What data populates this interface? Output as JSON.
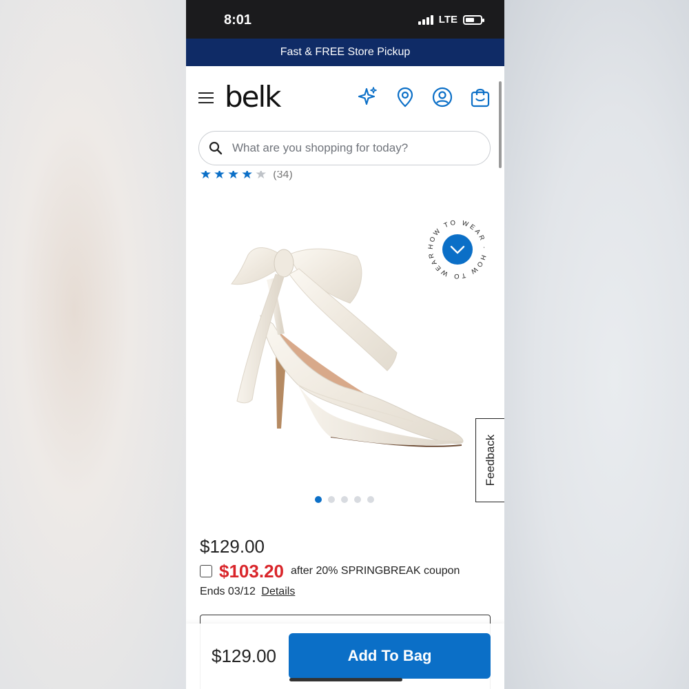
{
  "status_bar": {
    "time": "8:01",
    "network": "LTE"
  },
  "promo_banner": {
    "text": "Fast & FREE Store Pickup"
  },
  "header": {
    "logo": "belk",
    "icons": [
      "menu-icon",
      "sparkle-icon",
      "location-pin-icon",
      "account-icon",
      "shopping-bag-icon"
    ]
  },
  "search": {
    "placeholder": "What are you shopping for today?"
  },
  "rating": {
    "stars": 4,
    "count": "(34)"
  },
  "product": {
    "image_icon": "white-satin-bow-pump-image",
    "how_to_wear_label": "HOW TO WEAR · HOW TO WEAR ·",
    "feedback_label": "Feedback",
    "carousel": {
      "total": 5,
      "active": 0
    }
  },
  "pricing": {
    "regular": "$129.00",
    "coupon_price": "$103.20",
    "coupon_text": "after 20% SPRINGBREAK coupon",
    "ends": "Ends 03/12",
    "details_link": "Details"
  },
  "bottom_bar": {
    "price": "$129.00",
    "add_to_bag_label": "Add To Bag"
  },
  "colors": {
    "navy_banner": "#0f2b66",
    "brand_blue": "#0b6fc7",
    "coupon_red": "#d9252a"
  }
}
